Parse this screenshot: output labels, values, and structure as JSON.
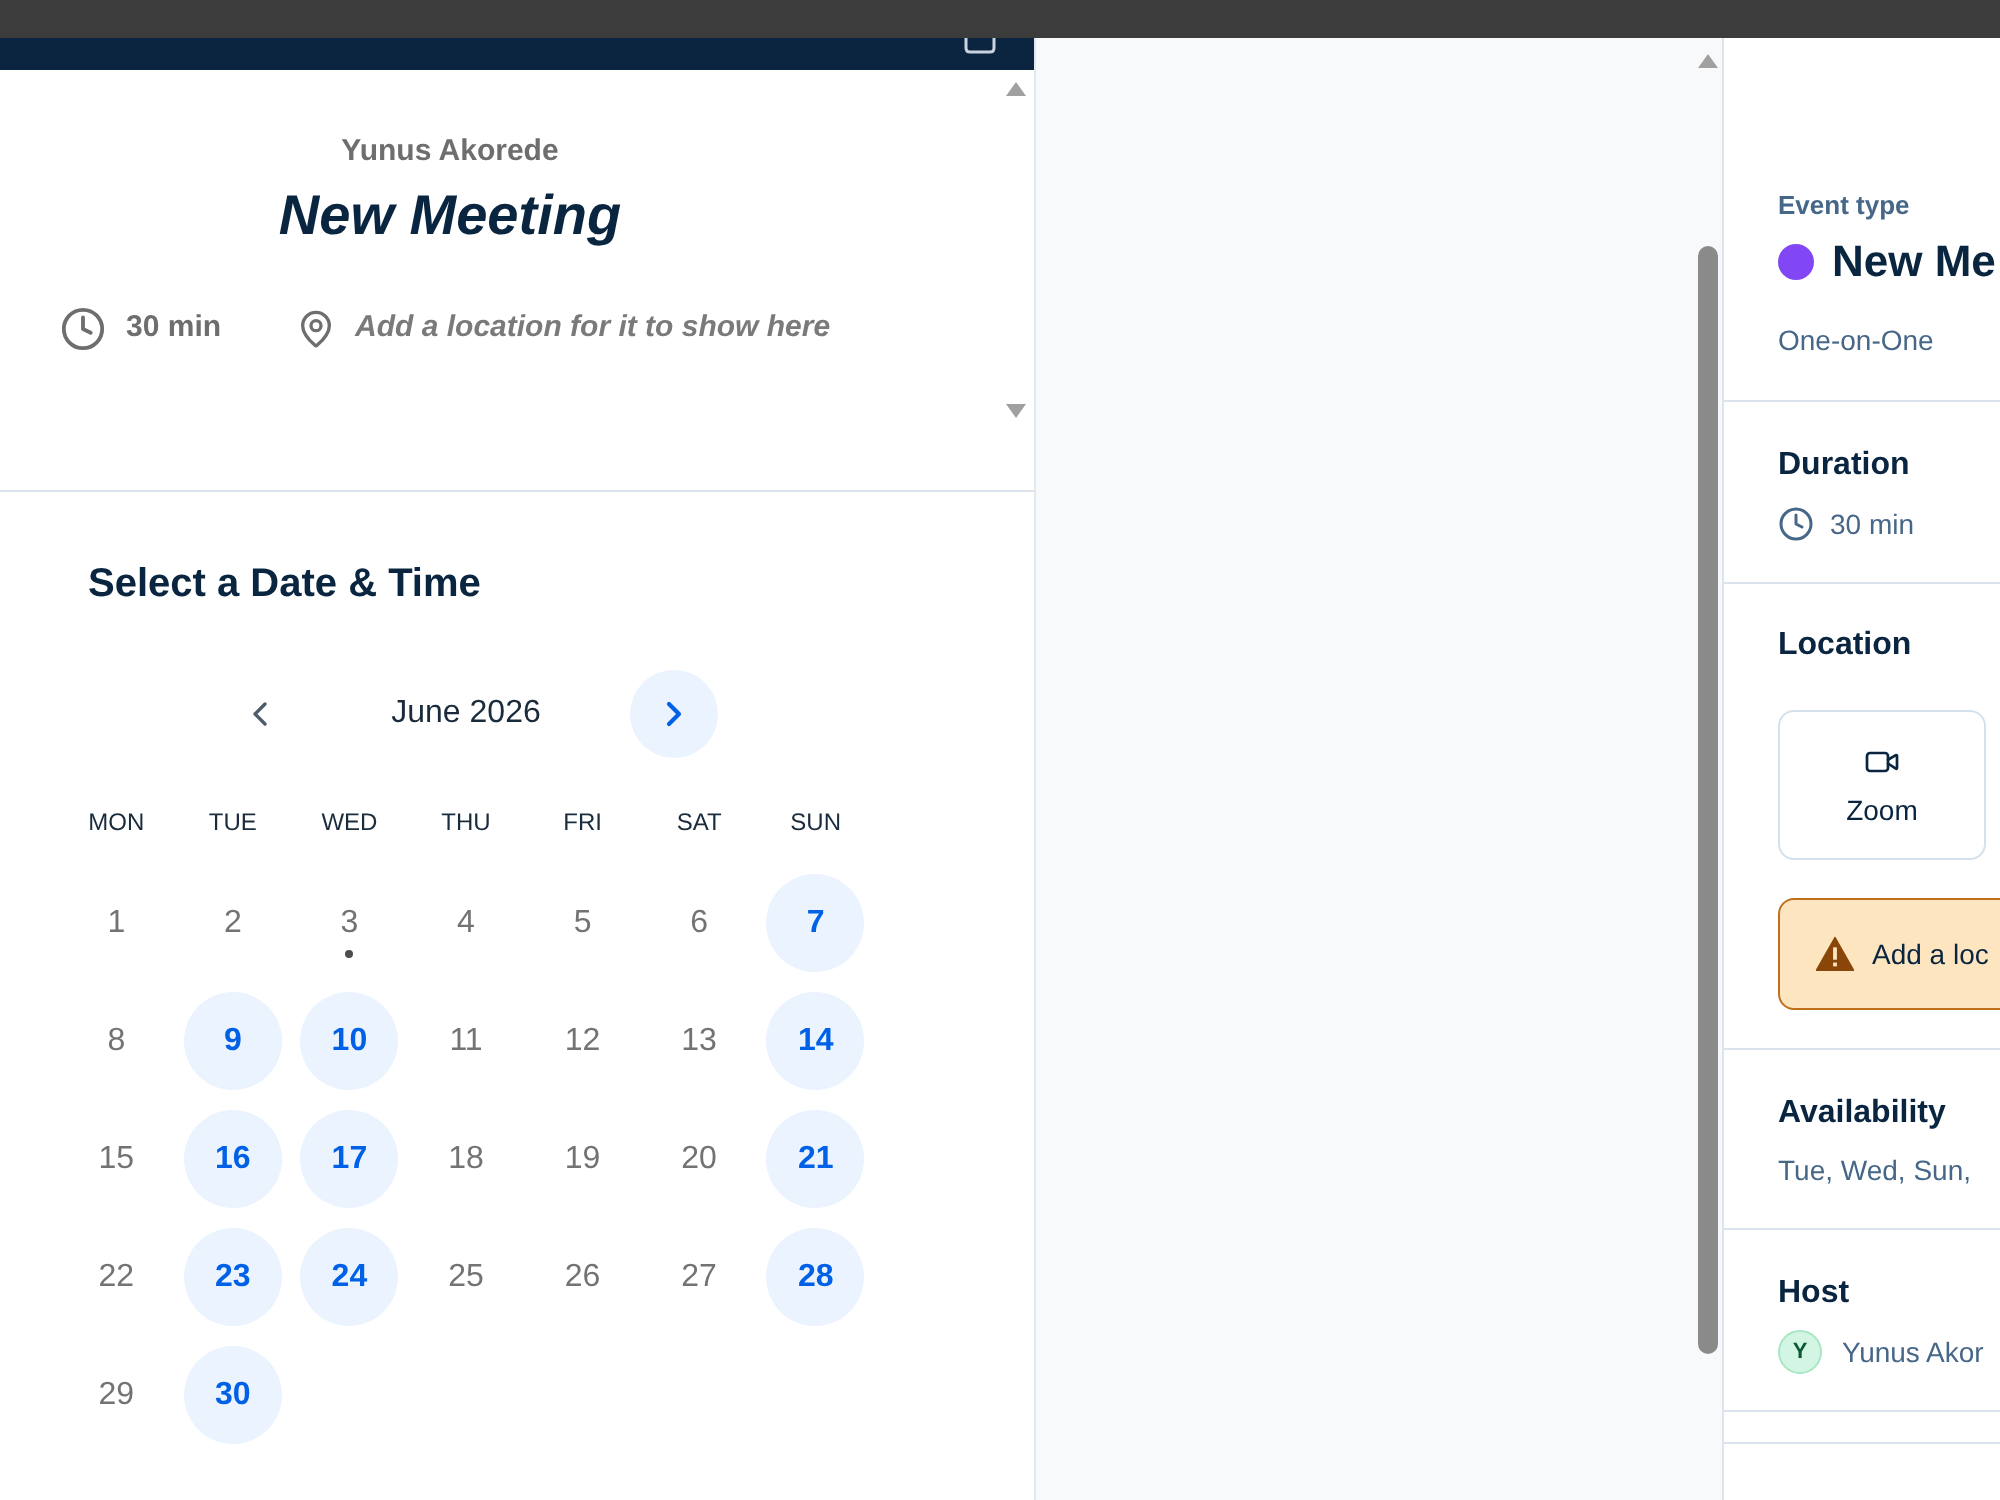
{
  "header": {
    "host": "Yunus Akorede",
    "title": "New Meeting",
    "duration": "30 min",
    "location_hint": "Add a location for it to show here"
  },
  "calendar": {
    "heading": "Select a Date & Time",
    "month": "June 2026",
    "weekdays": [
      "MON",
      "TUE",
      "WED",
      "THU",
      "FRI",
      "SAT",
      "SUN"
    ],
    "days": [
      {
        "label": "1",
        "available": false,
        "today": false,
        "selected": false
      },
      {
        "label": "2",
        "available": false,
        "today": false,
        "selected": false
      },
      {
        "label": "3",
        "available": false,
        "today": true,
        "selected": false
      },
      {
        "label": "4",
        "available": false,
        "today": false,
        "selected": false
      },
      {
        "label": "5",
        "available": false,
        "today": false,
        "selected": false
      },
      {
        "label": "6",
        "available": false,
        "today": false,
        "selected": false
      },
      {
        "label": "7",
        "available": true,
        "today": false,
        "selected": false
      },
      {
        "label": "8",
        "available": false,
        "today": false,
        "selected": false
      },
      {
        "label": "9",
        "available": true,
        "today": false,
        "selected": false
      },
      {
        "label": "10",
        "available": true,
        "today": false,
        "selected": false
      },
      {
        "label": "11",
        "available": false,
        "today": false,
        "selected": false
      },
      {
        "label": "12",
        "available": false,
        "today": false,
        "selected": false
      },
      {
        "label": "13",
        "available": false,
        "today": false,
        "selected": false
      },
      {
        "label": "14",
        "available": true,
        "today": false,
        "selected": false
      },
      {
        "label": "15",
        "available": false,
        "today": false,
        "selected": false
      },
      {
        "label": "16",
        "available": true,
        "today": false,
        "selected": false
      },
      {
        "label": "17",
        "available": true,
        "today": false,
        "selected": false
      },
      {
        "label": "18",
        "available": false,
        "today": false,
        "selected": false
      },
      {
        "label": "19",
        "available": false,
        "today": false,
        "selected": false
      },
      {
        "label": "20",
        "available": false,
        "today": false,
        "selected": false
      },
      {
        "label": "21",
        "available": true,
        "today": false,
        "selected": false
      },
      {
        "label": "22",
        "available": false,
        "today": false,
        "selected": false
      },
      {
        "label": "23",
        "available": true,
        "today": false,
        "selected": false
      },
      {
        "label": "24",
        "available": true,
        "today": false,
        "selected": false
      },
      {
        "label": "25",
        "available": false,
        "today": false,
        "selected": false
      },
      {
        "label": "26",
        "available": false,
        "today": false,
        "selected": false
      },
      {
        "label": "27",
        "available": false,
        "today": false,
        "selected": false
      },
      {
        "label": "28",
        "available": true,
        "today": false,
        "selected": false
      },
      {
        "label": "29",
        "available": false,
        "today": false,
        "selected": false
      },
      {
        "label": "30",
        "available": true,
        "today": false,
        "selected": false
      }
    ]
  },
  "details": {
    "label": "Event type",
    "event_name": "New Me",
    "event_kind": "One-on-One",
    "sections": [
      {
        "kind": "duration",
        "title": "Duration",
        "value": "30 min"
      },
      {
        "kind": "location",
        "title": "Location",
        "options": [
          {
            "label": "Zoom"
          }
        ],
        "warning": "Add a loc"
      },
      {
        "kind": "availability",
        "title": "Availability",
        "value": "Tue, Wed, Sun,"
      },
      {
        "kind": "host",
        "title": "Host",
        "initial": "Y",
        "name": "Yunus Akor"
      },
      {
        "kind": "empty"
      }
    ]
  }
}
